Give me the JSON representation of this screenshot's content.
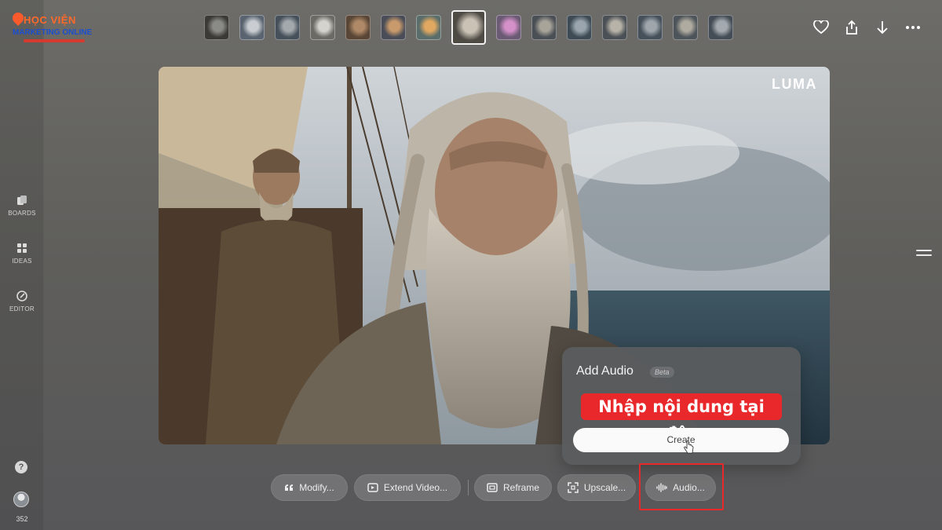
{
  "logo": {
    "line1": "HỌC VIỆN",
    "line2": "MARKETING ONLINE"
  },
  "sidebar": {
    "items": [
      {
        "label": "BOARDS",
        "icon": "boards-icon"
      },
      {
        "label": "IDEAS",
        "icon": "ideas-icon"
      },
      {
        "label": "EDITOR",
        "icon": "editor-icon"
      }
    ],
    "help": "?",
    "credits": "352"
  },
  "thumbnails": {
    "count": 15,
    "active_index": 7
  },
  "top_actions": [
    "heart-icon",
    "share-icon",
    "download-icon",
    "more-icon"
  ],
  "video": {
    "watermark": "LUMA"
  },
  "audio_panel": {
    "title": "Add Audio",
    "badge": "Beta",
    "callout": "Nhập nội dung tại đây",
    "create_label": "Create"
  },
  "toolbar": {
    "modify": "Modify...",
    "extend": "Extend Video...",
    "reframe": "Reframe",
    "upscale": "Upscale...",
    "audio": "Audio..."
  },
  "colors": {
    "callout": "#e8282a",
    "highlight": "#e8282a",
    "logo_orange": "#ff6a2b",
    "logo_blue": "#1a4fcf"
  }
}
